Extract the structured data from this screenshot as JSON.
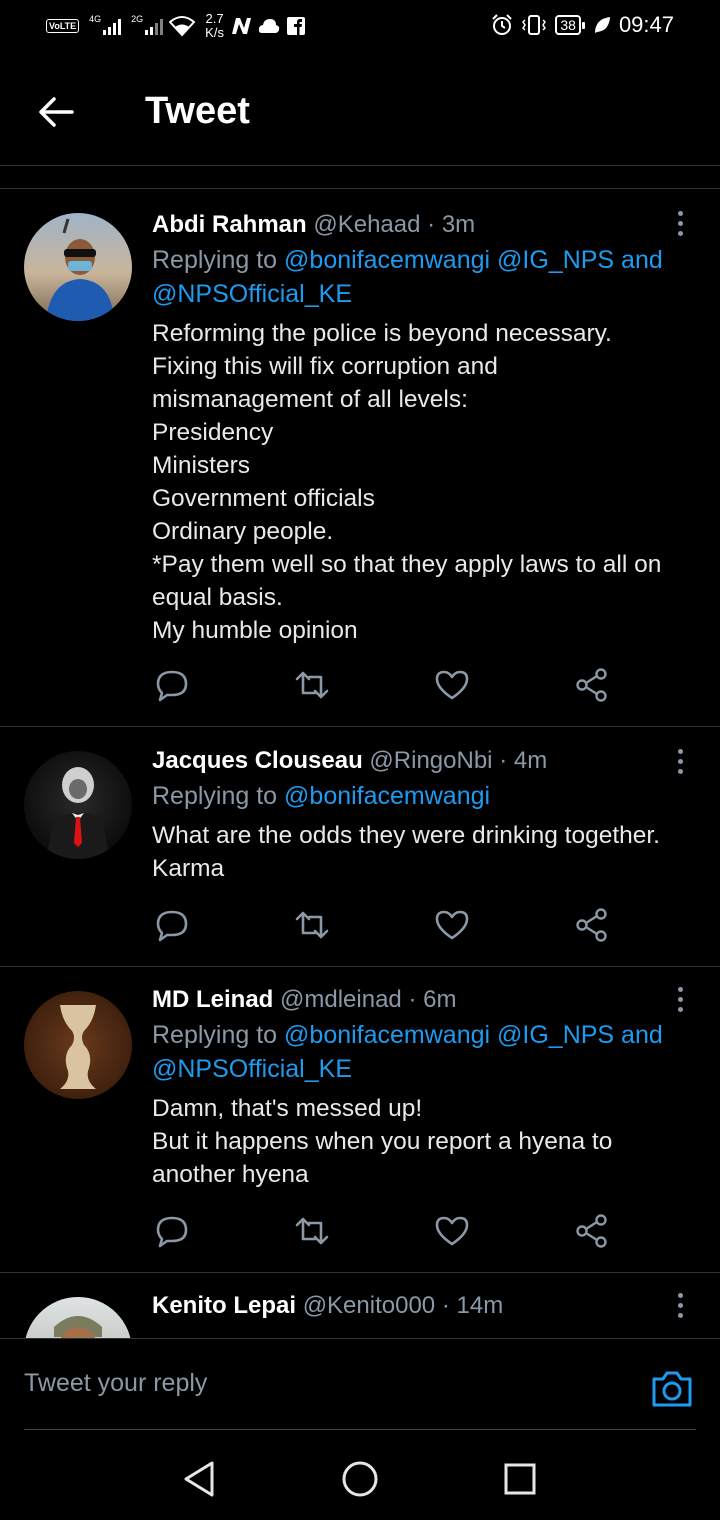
{
  "status_bar": {
    "volte": "VoLTE",
    "sig1_label": "4G",
    "sig2_label": "2G",
    "net_speed": "2.7",
    "net_unit": "K/s",
    "battery": "38",
    "time": "09:47"
  },
  "header": {
    "title": "Tweet"
  },
  "tweets": [
    {
      "name": "Abdi Rahman",
      "handle": "@Kehaad",
      "time": "3m",
      "replying_prefix": "Replying to ",
      "mentions_line": "@bonifacemwangi @IG_NPS and",
      "mentions_line2": "@NPSOfficial_KE",
      "text": "Reforming the police is beyond necessary.\nFixing this will fix corruption  and\nmismanagement of all levels:\nPresidency\nMinisters\nGovernment officials\nOrdinary people.\n*Pay them well so that they apply laws to all on\nequal basis.\nMy  humble opinion"
    },
    {
      "name": "Jacques Clouseau",
      "handle": "@RingoNbi",
      "time": "4m",
      "replying_prefix": "Replying to ",
      "mentions_line": "@bonifacemwangi",
      "text": "What are the odds they were drinking together.\nKarma"
    },
    {
      "name": "MD Leinad",
      "handle": "@mdleinad",
      "time": "6m",
      "replying_prefix": "Replying to ",
      "mentions_line": "@bonifacemwangi @IG_NPS and",
      "mentions_line2": "@NPSOfficial_KE",
      "text": "Damn, that's messed up!\nBut it happens when you report a hyena to\nanother hyena"
    },
    {
      "name": "Kenito Lepai",
      "handle": "@Kenito000",
      "time": "14m"
    }
  ],
  "dot": "·",
  "reply_bar": {
    "placeholder": "Tweet your reply"
  },
  "icons": {
    "accent": "#1d9bf0",
    "muted": "#8b98a5"
  }
}
